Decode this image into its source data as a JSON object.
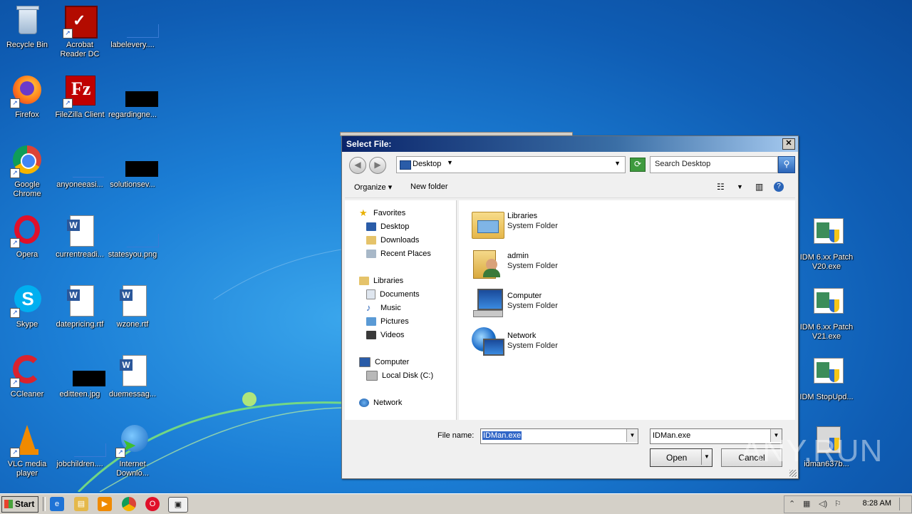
{
  "desktop": {
    "icons": [
      {
        "label": "Recycle Bin",
        "icon": "recycle-bin-icon"
      },
      {
        "label": "Acrobat Reader DC",
        "icon": "acrobat-icon"
      },
      {
        "label": "labelevery....",
        "icon": "blank-file-icon"
      },
      {
        "label": "Firefox",
        "icon": "firefox-icon"
      },
      {
        "label": "FileZilla Client",
        "icon": "filezilla-icon"
      },
      {
        "label": "regardingne...",
        "icon": "black-image-icon"
      },
      {
        "label": "Google Chrome",
        "icon": "chrome-icon"
      },
      {
        "label": "anyoneeasi...",
        "icon": "blank-file-icon"
      },
      {
        "label": "solutionsev...",
        "icon": "black-image-icon"
      },
      {
        "label": "Opera",
        "icon": "opera-icon"
      },
      {
        "label": "currentreadi...",
        "icon": "word-doc-icon"
      },
      {
        "label": "statesyou.png",
        "icon": "blank-file-icon"
      },
      {
        "label": "Skype",
        "icon": "skype-icon"
      },
      {
        "label": "datepricing.rtf",
        "icon": "word-doc-icon"
      },
      {
        "label": "wzone.rtf",
        "icon": "word-doc-icon"
      },
      {
        "label": "CCleaner",
        "icon": "ccleaner-icon"
      },
      {
        "label": "editteen.jpg",
        "icon": "black-image-icon"
      },
      {
        "label": "duemessag...",
        "icon": "word-doc-icon"
      },
      {
        "label": "VLC media player",
        "icon": "vlc-icon"
      },
      {
        "label": "jobchildren....",
        "icon": "blank-file-icon"
      },
      {
        "label": "Internet Downlo...",
        "icon": "idm-icon"
      },
      {
        "label": "IDM 6.xx Patch V20.exe",
        "icon": "idm-patch-icon"
      },
      {
        "label": "IDM 6.xx Patch V21.exe",
        "icon": "idm-patch-icon"
      },
      {
        "label": "IDM StopUpd...",
        "icon": "idm-patch-icon"
      },
      {
        "label": "idman637b...",
        "icon": "installer-icon"
      }
    ]
  },
  "dialog": {
    "title": "Select File:",
    "close_glyph": "✕",
    "address": "Desktop",
    "search_placeholder": "Search Desktop",
    "toolbar": {
      "organize": "Organize",
      "new_folder": "New folder"
    },
    "nav": {
      "favorites": "Favorites",
      "desktop": "Desktop",
      "downloads": "Downloads",
      "recent_places": "Recent Places",
      "libraries": "Libraries",
      "documents": "Documents",
      "music": "Music",
      "pictures": "Pictures",
      "videos": "Videos",
      "computer": "Computer",
      "local_disk": "Local Disk (C:)",
      "network": "Network"
    },
    "files": [
      {
        "name": "Libraries",
        "type": "System Folder"
      },
      {
        "name": "admin",
        "type": "System Folder"
      },
      {
        "name": "Computer",
        "type": "System Folder"
      },
      {
        "name": "Network",
        "type": "System Folder"
      }
    ],
    "file_name_label": "File name:",
    "file_name_value": "IDMan.exe",
    "file_filter": "IDMan.exe",
    "open_label": "Open",
    "cancel_label": "Cancel"
  },
  "watermark": "ANY.RUN",
  "taskbar": {
    "start_label": "Start",
    "clock": "8:28 AM"
  },
  "colors": {
    "desktop_blue": "#1c7fd6",
    "title_bar": "#0a246a",
    "selection": "#3166c7"
  }
}
